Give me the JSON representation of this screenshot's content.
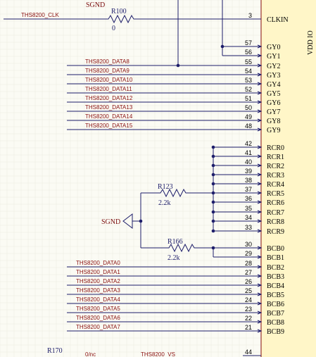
{
  "nets": {
    "clk": "THS8200_CLK",
    "gy2": "THS8200_DATA8",
    "gy3": "THS8200_DATA9",
    "gy4": "THS8200_DATA10",
    "gy5": "THS8200_DATA11",
    "gy6": "THS8200_DATA12",
    "gy7": "THS8200_DATA13",
    "gy8": "THS8200_DATA14",
    "gy9": "THS8200_DATA15",
    "bcb2": "THS8200_DATA0",
    "bcb3": "THS8200_DATA1",
    "bcb4": "THS8200_DATA2",
    "bcb5": "THS8200_DATA3",
    "bcb6": "THS8200_DATA4",
    "bcb7": "THS8200_DATA5",
    "bcb8": "THS8200_DATA6",
    "bcb9": "THS8200_DATA7",
    "bottom": "THS8200_VS",
    "sgnd_top": "SGND",
    "sgnd_mid": "SGND"
  },
  "components": {
    "r100_ref": "R100",
    "r100_val": "0",
    "r123_ref": "R123",
    "r123_val": "2.2k",
    "r166_ref": "R166",
    "r166_val": "2.2k",
    "r170_ref": "R170",
    "r170_val": "0/nc"
  },
  "chip": {
    "vertical_label": "VDD IO",
    "pins": [
      {
        "num": "3",
        "name": "CLKIN"
      },
      {
        "num": "57",
        "name": "GY0"
      },
      {
        "num": "56",
        "name": "GY1"
      },
      {
        "num": "55",
        "name": "GY2"
      },
      {
        "num": "54",
        "name": "GY3"
      },
      {
        "num": "53",
        "name": "GY4"
      },
      {
        "num": "52",
        "name": "GY5"
      },
      {
        "num": "51",
        "name": "GY6"
      },
      {
        "num": "50",
        "name": "GY7"
      },
      {
        "num": "49",
        "name": "GY8"
      },
      {
        "num": "48",
        "name": "GY9"
      },
      {
        "num": "42",
        "name": "RCR0"
      },
      {
        "num": "41",
        "name": "RCR1"
      },
      {
        "num": "40",
        "name": "RCR2"
      },
      {
        "num": "39",
        "name": "RCR3"
      },
      {
        "num": "38",
        "name": "RCR4"
      },
      {
        "num": "37",
        "name": "RCR5"
      },
      {
        "num": "36",
        "name": "RCR6"
      },
      {
        "num": "35",
        "name": "RCR7"
      },
      {
        "num": "34",
        "name": "RCR8"
      },
      {
        "num": "33",
        "name": "RCR9"
      },
      {
        "num": "30",
        "name": "BCB0"
      },
      {
        "num": "29",
        "name": "BCB1"
      },
      {
        "num": "28",
        "name": "BCB2"
      },
      {
        "num": "27",
        "name": "BCB3"
      },
      {
        "num": "26",
        "name": "BCB4"
      },
      {
        "num": "25",
        "name": "BCB5"
      },
      {
        "num": "24",
        "name": "BCB6"
      },
      {
        "num": "23",
        "name": "BCB7"
      },
      {
        "num": "22",
        "name": "BCB8"
      },
      {
        "num": "21",
        "name": "BCB9"
      },
      {
        "num": "44",
        "name": ""
      }
    ]
  },
  "colors": {
    "wire": "#1d1d6a",
    "net_label": "#8a1010",
    "chip_fill": "#fff6c8",
    "background": "#fbfbf4"
  }
}
